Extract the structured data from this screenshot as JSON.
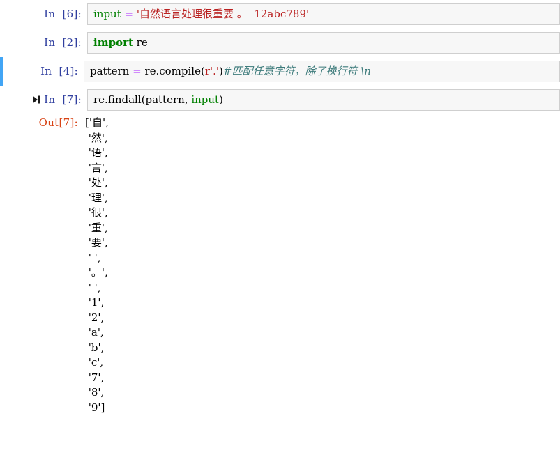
{
  "notebook": {
    "cells": [
      {
        "kind": "code",
        "prompt": "In  [6]:",
        "selected": false,
        "has_run_icon": false,
        "tokens": [
          {
            "t": "input",
            "c": "builtin"
          },
          {
            "t": " ",
            "c": "plain"
          },
          {
            "t": "=",
            "c": "op"
          },
          {
            "t": " ",
            "c": "plain"
          },
          {
            "t": "'自然语言处理很重要 。  12abc789'",
            "c": "string"
          }
        ]
      },
      {
        "kind": "code",
        "prompt": "In  [2]:",
        "selected": false,
        "has_run_icon": false,
        "tokens": [
          {
            "t": "import",
            "c": "kw"
          },
          {
            "t": " re",
            "c": "plain"
          }
        ]
      },
      {
        "kind": "code",
        "prompt": "In  [4]:",
        "selected": true,
        "has_run_icon": false,
        "tokens": [
          {
            "t": "pattern",
            "c": "plain"
          },
          {
            "t": " ",
            "c": "plain"
          },
          {
            "t": "=",
            "c": "op"
          },
          {
            "t": " re.compile(",
            "c": "plain"
          },
          {
            "t": "r'.'",
            "c": "string"
          },
          {
            "t": ")",
            "c": "plain"
          },
          {
            "t": "#匹配任意字符，除了换行符 \\n",
            "c": "comment"
          }
        ]
      },
      {
        "kind": "code",
        "prompt": "In  [7]:",
        "selected": false,
        "has_run_icon": true,
        "run_icon_name": "run-step-icon",
        "tokens": [
          {
            "t": "re.findall(pattern, ",
            "c": "plain"
          },
          {
            "t": "input",
            "c": "builtin"
          },
          {
            "t": ")",
            "c": "plain"
          }
        ]
      }
    ],
    "output": {
      "prompt": "Out[7]:",
      "lines": [
        "['自',",
        " '然',",
        " '语',",
        " '言',",
        " '处',",
        " '理',",
        " '很',",
        " '重',",
        " '要',",
        " ' ',",
        " '。',",
        " ' ',",
        " '1',",
        " '2',",
        " 'a',",
        " 'b',",
        " 'c',",
        " '7',",
        " '8',",
        " '9']"
      ]
    }
  },
  "colors": {
    "selected_bar": "#42A5F5",
    "input_prompt": "#303F9F",
    "output_prompt": "#D84315",
    "cell_bg": "#f7f7f7",
    "cell_border": "#cfcfcf",
    "string": "#BA2121",
    "builtin": "#008000",
    "operator": "#AA22FF",
    "comment": "#3D7B7B"
  }
}
